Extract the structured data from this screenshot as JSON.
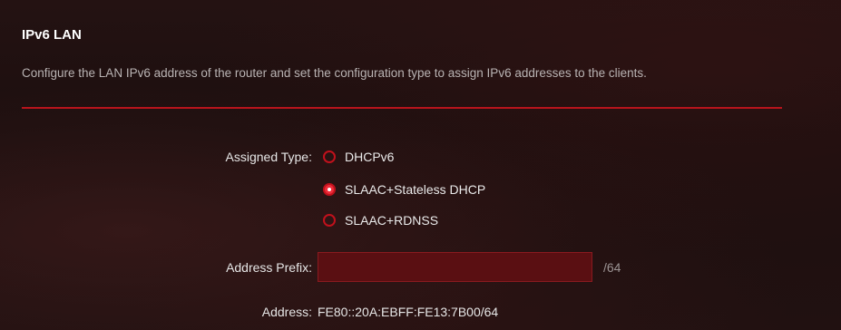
{
  "section": {
    "title": "IPv6 LAN",
    "description": "Configure the LAN IPv6 address of the router and set the configuration type to assign IPv6 addresses to the clients."
  },
  "assigned_type": {
    "label": "Assigned Type:",
    "options": [
      {
        "label": "DHCPv6",
        "checked": false
      },
      {
        "label": "SLAAC+Stateless DHCP",
        "checked": true
      },
      {
        "label": "SLAAC+RDNSS",
        "checked": false
      }
    ]
  },
  "address_prefix": {
    "label": "Address Prefix:",
    "value": "",
    "placeholder": "",
    "suffix": "/64"
  },
  "address": {
    "label": "Address:",
    "value": "FE80::20A:EBFF:FE13:7B00/64"
  },
  "colors": {
    "accent": "#c0111c",
    "input_background": "#5a0f12"
  }
}
